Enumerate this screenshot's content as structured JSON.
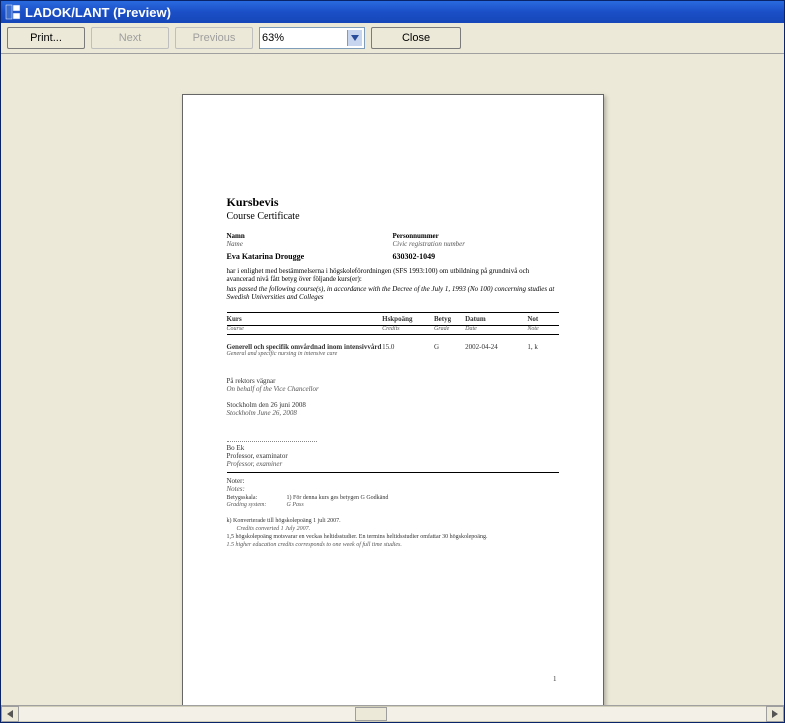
{
  "window": {
    "title": "LADOK/LANT (Preview)"
  },
  "toolbar": {
    "print": "Print...",
    "next": "Next",
    "previous": "Previous",
    "zoom": "63%",
    "close": "Close"
  },
  "document": {
    "title": "Kursbevis",
    "subtitle": "Course Certificate",
    "name_label_sv": "Namn",
    "name_label_en": "Name",
    "pnr_label_sv": "Personnummer",
    "pnr_label_en": "Civic registration number",
    "student_name": "Eva Katarina Drougge",
    "student_pnr": "630302-1049",
    "intro_sv": "har i enlighet med bestämmelserna i högskoleförordningen (SFS 1993:100) om utbildning på grundnivå och avancerad nivå fått betyg över följande kurs(er):",
    "intro_en": "has passed the following course(s), in accordance with the Decree of the July 1, 1993 (No 100) concerning studies at Swedish Universities and Colleges",
    "table": {
      "headers_sv": {
        "course": "Kurs",
        "credits": "Hskpoäng",
        "grade": "Betyg",
        "date": "Datum",
        "note": "Not"
      },
      "headers_en": {
        "course": "Course",
        "credits": "Credits",
        "grade": "Grade",
        "date": "Date",
        "note": "Note"
      },
      "rows": [
        {
          "title_sv": "Generell och specifik omvårdnad inom intensivvård",
          "title_en": "General and specific nursing in intensive care",
          "credits": "15.0",
          "grade": "G",
          "date": "2002-04-24",
          "note": "1, k"
        }
      ]
    },
    "behalf_sv": "På rektors vägnar",
    "behalf_en": "On behalf of the Vice Chancellor",
    "place_date_sv": "Stockholm den 26 juni 2008",
    "place_date_en": "Stockholm June 26, 2008",
    "signer_name": "Bo Ek",
    "signer_title_sv": "Professor, examinator",
    "signer_title_en": "Professor, examiner",
    "notes_hdr_sv": "Noter:",
    "notes_hdr_en": "Notes:",
    "grading_label_sv": "Betygsskala:",
    "grading_label_en": "Grading system:",
    "grading_text_sv": "1)  För denna kurs ges betygen G Godkänd",
    "grading_text_en": "G Pass",
    "note_k_sv": "k)  Konverterade till högskolepoäng 1 juli 2007.",
    "note_k_en": "Credits converted 1 July 2007.",
    "hp_explain_sv": "1,5 högskolepoäng motsvarar en veckas heltidsstudier. En termins heltidsstudier omfattar 30 högskolepoäng.",
    "hp_explain_en": "1.5 higher education credits corresponds to one week of full time studies.",
    "page_number": "1"
  }
}
